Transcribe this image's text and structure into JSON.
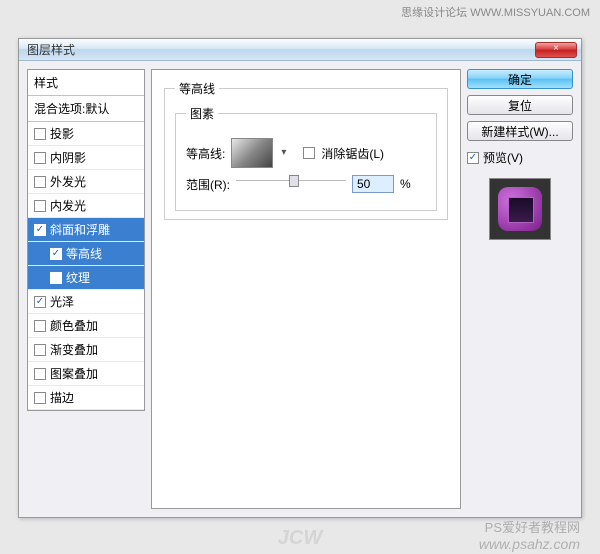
{
  "topbar": {
    "text": "思缘设计论坛  WWW.MISSYUAN.COM"
  },
  "window": {
    "title": "图层样式",
    "close": "×"
  },
  "styles": {
    "header": "样式",
    "blend": "混合选项:默认",
    "items": [
      {
        "label": "投影",
        "checked": false
      },
      {
        "label": "内阴影",
        "checked": false
      },
      {
        "label": "外发光",
        "checked": false
      },
      {
        "label": "内发光",
        "checked": false
      },
      {
        "label": "斜面和浮雕",
        "checked": true,
        "selected": false
      },
      {
        "label": "等高线",
        "checked": true,
        "indent": true,
        "selected": true
      },
      {
        "label": "纹理",
        "checked": false,
        "indent": true,
        "selected": true
      },
      {
        "label": "光泽",
        "checked": true
      },
      {
        "label": "颜色叠加",
        "checked": false
      },
      {
        "label": "渐变叠加",
        "checked": false
      },
      {
        "label": "图案叠加",
        "checked": false
      },
      {
        "label": "描边",
        "checked": false
      }
    ]
  },
  "main": {
    "section_title": "等高线",
    "group_title": "图素",
    "contour_label": "等高线:",
    "antialiased_label": "消除锯齿(L)",
    "range_label": "范围(R):",
    "range_value": "50",
    "range_unit": "%"
  },
  "buttons": {
    "ok": "确定",
    "cancel": "复位",
    "newstyle": "新建样式(W)...",
    "preview": "预览(V)"
  },
  "watermarks": {
    "center": "JCW",
    "tutorial": "PS爱好者教程网",
    "url": "www.psahz.com"
  }
}
